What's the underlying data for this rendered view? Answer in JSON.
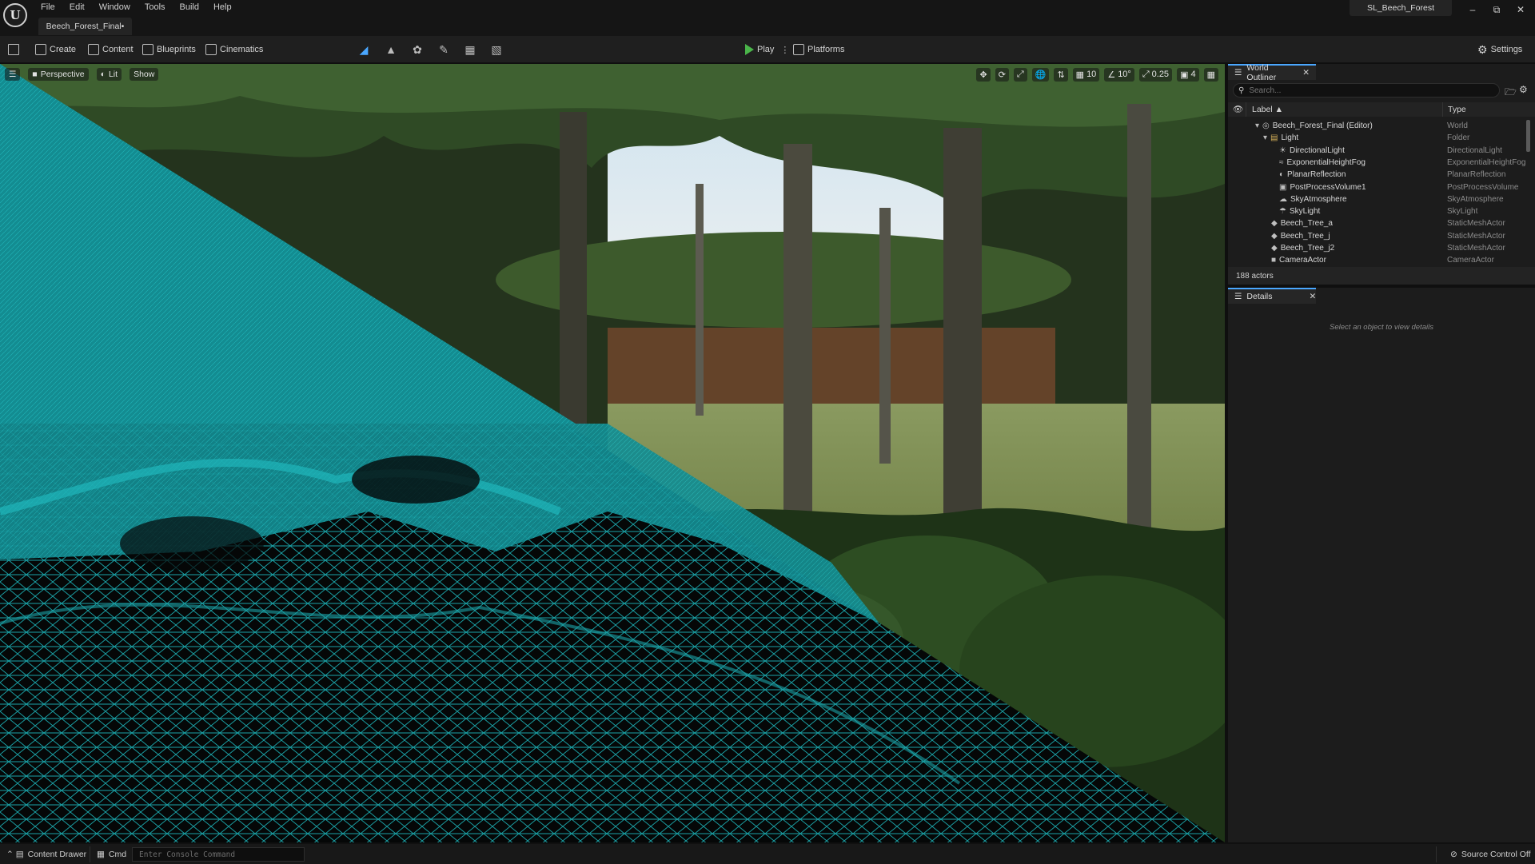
{
  "menubar": {
    "logo_glyph": "U",
    "menus": [
      "File",
      "Edit",
      "Window",
      "Tools",
      "Build",
      "Help"
    ],
    "document_tab": "Beech_Forest_Final•",
    "project_name": "SL_Beech_Forest"
  },
  "toolbar": {
    "create": "Create",
    "content": "Content",
    "blueprints": "Blueprints",
    "cinematics": "Cinematics",
    "play": "Play",
    "platforms": "Platforms",
    "settings": "Settings"
  },
  "viewport": {
    "perspective": "Perspective",
    "lit": "Lit",
    "show": "Show",
    "grid_snap": "10",
    "rotation_snap": "10°",
    "scale_snap": "0.25",
    "camera_speed": "4",
    "wireframe_color": "#1aa3a8"
  },
  "outliner": {
    "tab_title": "World Outliner",
    "search_placeholder": "Search...",
    "col_label": "Label",
    "col_type": "Type",
    "rows": [
      {
        "label": "Beech_Forest_Final (Editor)",
        "type": "World",
        "icon": "world-icon"
      },
      {
        "label": "Light",
        "type": "Folder",
        "icon": "folder-icon"
      },
      {
        "label": "DirectionalLight",
        "type": "DirectionalLight",
        "icon": "sun-icon"
      },
      {
        "label": "ExponentialHeightFog",
        "type": "ExponentialHeightFog",
        "icon": "fog-icon"
      },
      {
        "label": "PlanarReflection",
        "type": "PlanarReflection",
        "icon": "reflection-icon"
      },
      {
        "label": "PostProcessVolume1",
        "type": "PostProcessVolume",
        "icon": "volume-icon"
      },
      {
        "label": "SkyAtmosphere",
        "type": "SkyAtmosphere",
        "icon": "sky-icon"
      },
      {
        "label": "SkyLight",
        "type": "SkyLight",
        "icon": "skylight-icon"
      },
      {
        "label": "Beech_Tree_a",
        "type": "StaticMeshActor",
        "icon": "mesh-icon"
      },
      {
        "label": "Beech_Tree_j",
        "type": "StaticMeshActor",
        "icon": "mesh-icon"
      },
      {
        "label": "Beech_Tree_j2",
        "type": "StaticMeshActor",
        "icon": "mesh-icon"
      },
      {
        "label": "CameraActor",
        "type": "CameraActor",
        "icon": "camera-icon"
      }
    ],
    "actor_count": "188 actors"
  },
  "details": {
    "tab_title": "Details",
    "empty_message": "Select an object to view details"
  },
  "statusbar": {
    "content_drawer": "Content Drawer",
    "cmd": "Cmd",
    "console_placeholder": "Enter Console Command",
    "source_control": "Source Control Off"
  }
}
